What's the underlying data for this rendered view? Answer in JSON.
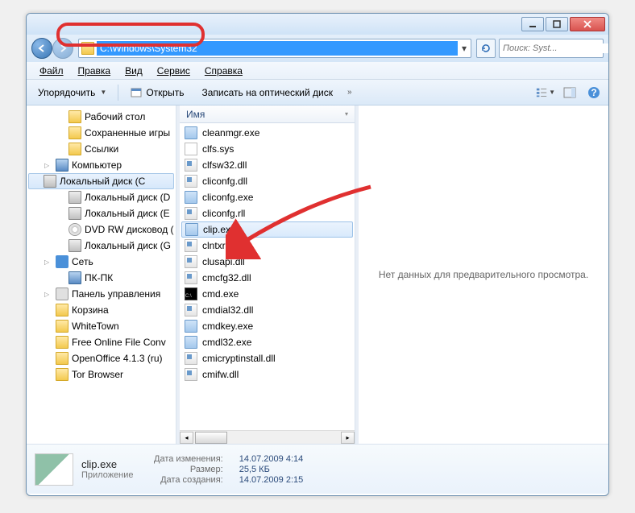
{
  "address": {
    "path": "C:\\Windows\\System32"
  },
  "search": {
    "placeholder": "Поиск: Syst..."
  },
  "menu": {
    "file": "Файл",
    "edit": "Правка",
    "view": "Вид",
    "tools": "Сервис",
    "help": "Справка"
  },
  "toolbar": {
    "organize": "Упорядочить",
    "open": "Открыть",
    "burn": "Записать на оптический диск"
  },
  "columns": {
    "name": "Имя"
  },
  "tree": [
    {
      "label": "Рабочий стол",
      "icon": "i-folder",
      "indent": 2
    },
    {
      "label": "Сохраненные игры",
      "icon": "i-folder",
      "indent": 2
    },
    {
      "label": "Ссылки",
      "icon": "i-folder",
      "indent": 2
    },
    {
      "label": "Компьютер",
      "icon": "i-comp",
      "indent": 1,
      "expandable": true
    },
    {
      "label": "Локальный диск (C",
      "icon": "i-drive",
      "indent": 2,
      "sel": true
    },
    {
      "label": "Локальный диск (D",
      "icon": "i-drive",
      "indent": 2
    },
    {
      "label": "Локальный диск (E",
      "icon": "i-drive",
      "indent": 2
    },
    {
      "label": "DVD RW дисковод (",
      "icon": "i-dvd",
      "indent": 2
    },
    {
      "label": "Локальный диск (G",
      "icon": "i-drive",
      "indent": 2
    },
    {
      "label": "Сеть",
      "icon": "i-net",
      "indent": 1,
      "expandable": true
    },
    {
      "label": "ПК-ПК",
      "icon": "i-comp",
      "indent": 2
    },
    {
      "label": "Панель управления",
      "icon": "i-gear",
      "indent": 1,
      "expandable": true
    },
    {
      "label": "Корзина",
      "icon": "i-folder",
      "indent": 1
    },
    {
      "label": "WhiteTown",
      "icon": "i-folder",
      "indent": 1
    },
    {
      "label": "Free Online File Conv",
      "icon": "i-folder",
      "indent": 1
    },
    {
      "label": "OpenOffice 4.1.3 (ru)",
      "icon": "i-folder",
      "indent": 1
    },
    {
      "label": "Tor Browser",
      "icon": "i-folder",
      "indent": 1
    }
  ],
  "files": [
    {
      "name": "cleanmgr.exe",
      "icon": "i-app"
    },
    {
      "name": "clfs.sys",
      "icon": "i-sys"
    },
    {
      "name": "clfsw32.dll",
      "icon": "i-dll"
    },
    {
      "name": "cliconfg.dll",
      "icon": "i-dll"
    },
    {
      "name": "cliconfg.exe",
      "icon": "i-app"
    },
    {
      "name": "cliconfg.rll",
      "icon": "i-dll"
    },
    {
      "name": "clip.exe",
      "icon": "i-app",
      "sel": true
    },
    {
      "name": "clntxres.dll",
      "icon": "i-dll"
    },
    {
      "name": "clusapi.dll",
      "icon": "i-dll"
    },
    {
      "name": "cmcfg32.dll",
      "icon": "i-dll"
    },
    {
      "name": "cmd.exe",
      "icon": "i-cmd"
    },
    {
      "name": "cmdial32.dll",
      "icon": "i-dll"
    },
    {
      "name": "cmdkey.exe",
      "icon": "i-app"
    },
    {
      "name": "cmdl32.exe",
      "icon": "i-app"
    },
    {
      "name": "cmicryptinstall.dll",
      "icon": "i-dll"
    },
    {
      "name": "cmifw.dll",
      "icon": "i-dll"
    }
  ],
  "preview": {
    "empty": "Нет данных для предварительного просмотра."
  },
  "details": {
    "name": "clip.exe",
    "type": "Приложение",
    "modified_label": "Дата изменения:",
    "modified": "14.07.2009 4:14",
    "size_label": "Размер:",
    "size": "25,5 КБ",
    "created_label": "Дата создания:",
    "created": "14.07.2009 2:15"
  }
}
